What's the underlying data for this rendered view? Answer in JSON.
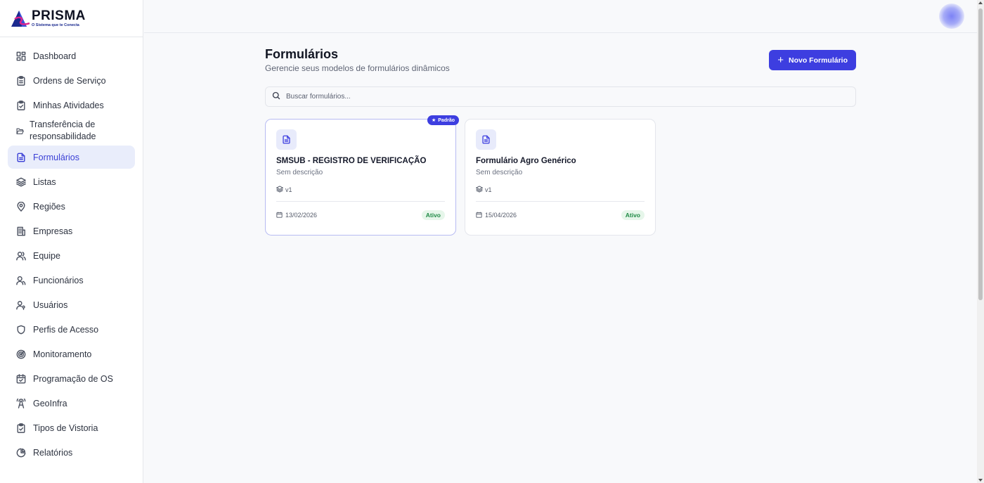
{
  "brand": {
    "name": "PRISMA",
    "tagline": "O Sistema que te Conecta"
  },
  "sidebar": {
    "items": [
      {
        "label": "Dashboard",
        "icon": "dashboard-icon"
      },
      {
        "label": "Ordens de Serviço",
        "icon": "clipboard-icon"
      },
      {
        "label": "Minhas Atividades",
        "icon": "clipboard-check-icon"
      },
      {
        "label": "Transferência de responsabilidade",
        "icon": "folder-open-icon"
      },
      {
        "label": "Formulários",
        "icon": "file-text-icon",
        "active": true
      },
      {
        "label": "Listas",
        "icon": "layers-icon"
      },
      {
        "label": "Regiões",
        "icon": "map-pin-icon"
      },
      {
        "label": "Empresas",
        "icon": "building-icon"
      },
      {
        "label": "Equipe",
        "icon": "users-icon"
      },
      {
        "label": "Funcionários",
        "icon": "user-group-icon"
      },
      {
        "label": "Usuários",
        "icon": "user-key-icon"
      },
      {
        "label": "Perfis de Acesso",
        "icon": "shield-icon"
      },
      {
        "label": "Monitoramento",
        "icon": "radar-icon"
      },
      {
        "label": "Programação de OS",
        "icon": "calendar-check-icon"
      },
      {
        "label": "GeoInfra",
        "icon": "tower-icon"
      },
      {
        "label": "Tipos de Vistoria",
        "icon": "clipboard-check-icon"
      },
      {
        "label": "Relatórios",
        "icon": "pie-chart-icon"
      }
    ]
  },
  "header": {
    "title": "Formulários",
    "subtitle": "Gerencie seus modelos de formulários dinâmicos",
    "new_button": "Novo Formulário"
  },
  "search": {
    "placeholder": "Buscar formulários...",
    "value": ""
  },
  "cards": [
    {
      "title": "SMSUB - REGISTRO DE VERIFICAÇÃO",
      "description": "Sem descrição",
      "version": "v1",
      "date": "13/02/2026",
      "status": "Ativo",
      "badge": "Padrão"
    },
    {
      "title": "Formulário Agro Genérico",
      "description": "Sem descrição",
      "version": "v1",
      "date": "15/04/2026",
      "status": "Ativo"
    }
  ],
  "colors": {
    "accent": "#3d3ee0",
    "active_bg": "#e9edfb",
    "status_green": "#1f8a45"
  }
}
